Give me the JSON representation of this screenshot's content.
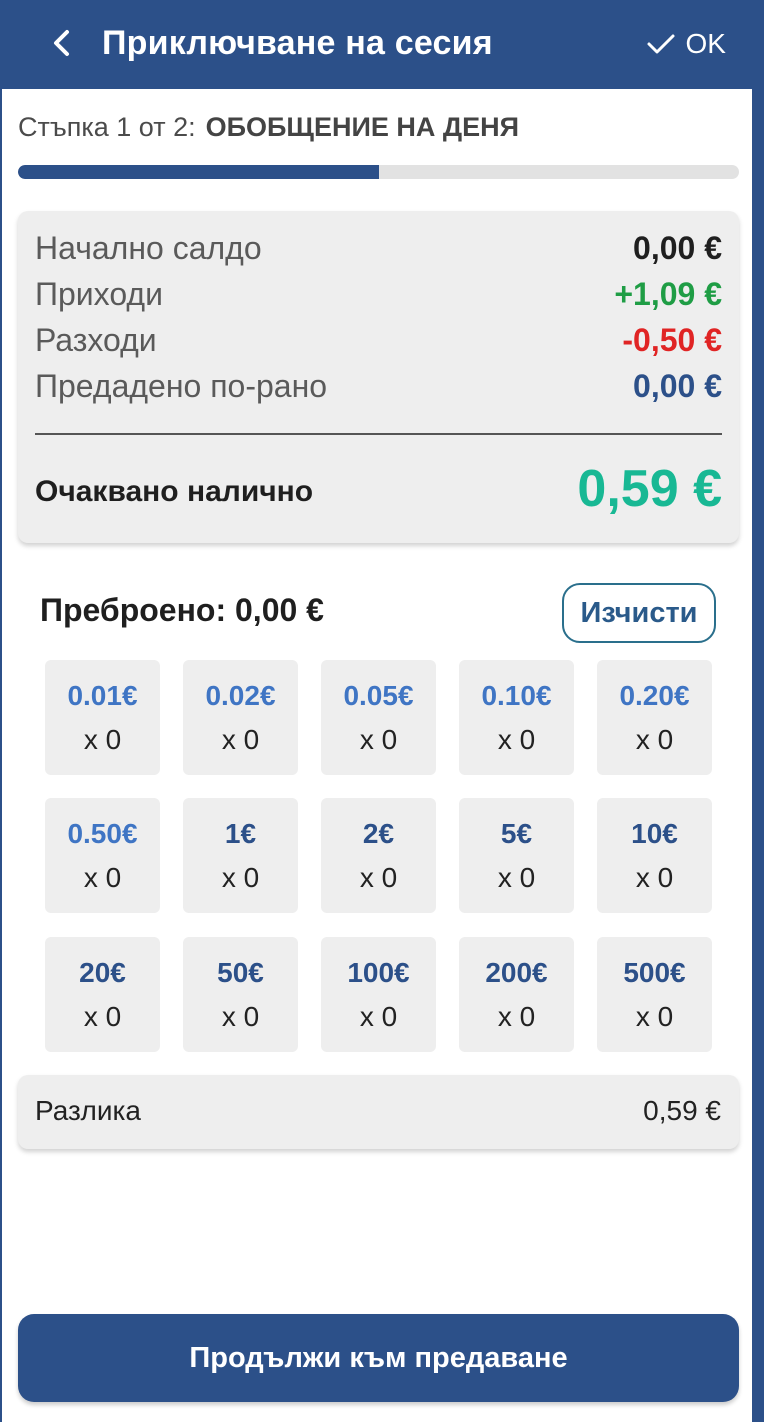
{
  "header": {
    "title": "Приключване на сесия",
    "ok_label": "OK"
  },
  "step": {
    "prefix": "Стъпка 1 от 2:",
    "name": "ОБОБЩЕНИЕ НА ДЕНЯ",
    "progress_fraction": 0.5
  },
  "summary": {
    "rows": [
      {
        "label": "Начално салдо",
        "value": "0,00 €",
        "color": "#1f1f1f"
      },
      {
        "label": "Приходи",
        "value": "+1,09 €",
        "color": "#1f9d45"
      },
      {
        "label": "Разходи",
        "value": "-0,50 €",
        "color": "#e02424"
      },
      {
        "label": "Предадено по-рано",
        "value": "0,00 €",
        "color": "#2c5089"
      }
    ],
    "expected_label": "Очаквано налично",
    "expected_value": "0,59 €"
  },
  "counting": {
    "counted_label": "Преброено: 0,00 €",
    "clear_label": "Изчисти",
    "denominations": [
      {
        "label": "0.01€",
        "qty": "x 0"
      },
      {
        "label": "0.02€",
        "qty": "x 0"
      },
      {
        "label": "0.05€",
        "qty": "x 0"
      },
      {
        "label": "0.10€",
        "qty": "x 0"
      },
      {
        "label": "0.20€",
        "qty": "x 0"
      },
      {
        "label": "0.50€",
        "qty": "x 0"
      },
      {
        "label": "1€",
        "qty": "x 0"
      },
      {
        "label": "2€",
        "qty": "x 0"
      },
      {
        "label": "5€",
        "qty": "x 0"
      },
      {
        "label": "10€",
        "qty": "x 0"
      },
      {
        "label": "20€",
        "qty": "x 0"
      },
      {
        "label": "50€",
        "qty": "x 0"
      },
      {
        "label": "100€",
        "qty": "x 0"
      },
      {
        "label": "200€",
        "qty": "x 0"
      },
      {
        "label": "500€",
        "qty": "x 0"
      }
    ]
  },
  "difference": {
    "label": "Разлика",
    "value": "0,59 €"
  },
  "footer": {
    "continue_label": "Продължи към предаване"
  },
  "colors": {
    "primary": "#2c5089",
    "coin_text": "#3f75c4",
    "expected": "#18b894"
  }
}
